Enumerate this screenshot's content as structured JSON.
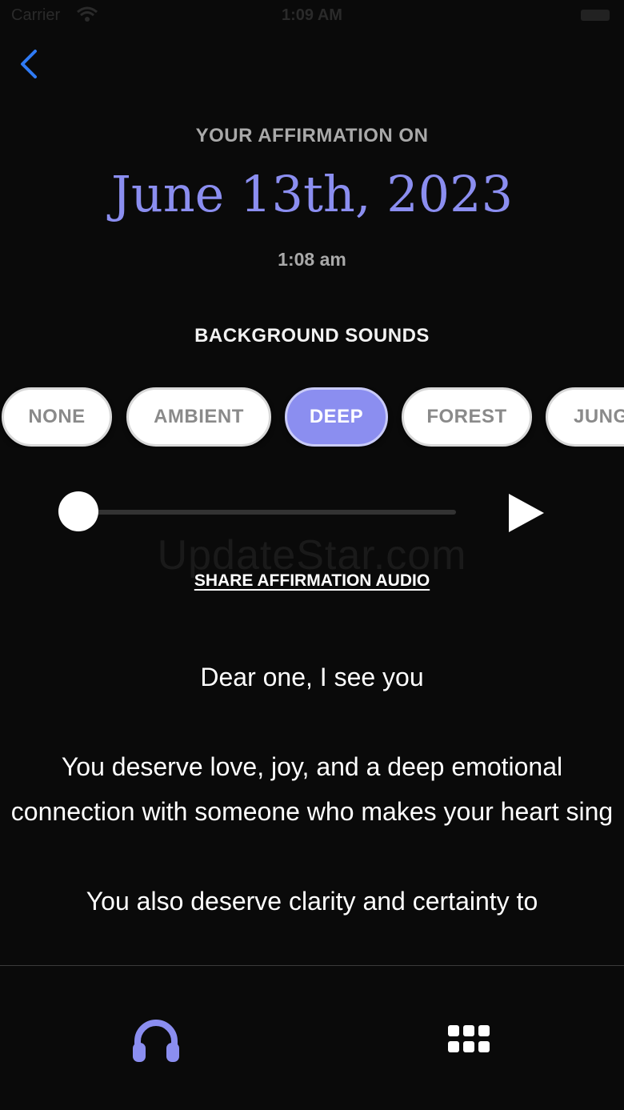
{
  "status_bar": {
    "carrier": "Carrier",
    "time": "1:09 AM"
  },
  "header": {
    "kicker": "YOUR AFFIRMATION ON",
    "date": "June 13th, 2023",
    "time": "1:08 am"
  },
  "sounds": {
    "title": "BACKGROUND SOUNDS",
    "options": [
      "NONE",
      "AMBIENT",
      "DEEP",
      "FOREST",
      "JUNG"
    ],
    "selected": "DEEP"
  },
  "player": {
    "progress": 0
  },
  "share": {
    "label": "SHARE AFFIRMATION AUDIO"
  },
  "watermark": "UpdateStar.com",
  "affirmation": {
    "paragraphs": [
      "Dear one, I see you",
      "You deserve love, joy, and a deep emotional connection with someone who makes your heart sing",
      "You also deserve clarity and certainty to"
    ]
  },
  "tab_bar": {
    "left_icon": "headphones-icon",
    "right_icon": "grid-icon"
  },
  "colors": {
    "accent": "#8b8ef0",
    "background": "#0a0a0a",
    "back_button": "#2f7bf5"
  }
}
